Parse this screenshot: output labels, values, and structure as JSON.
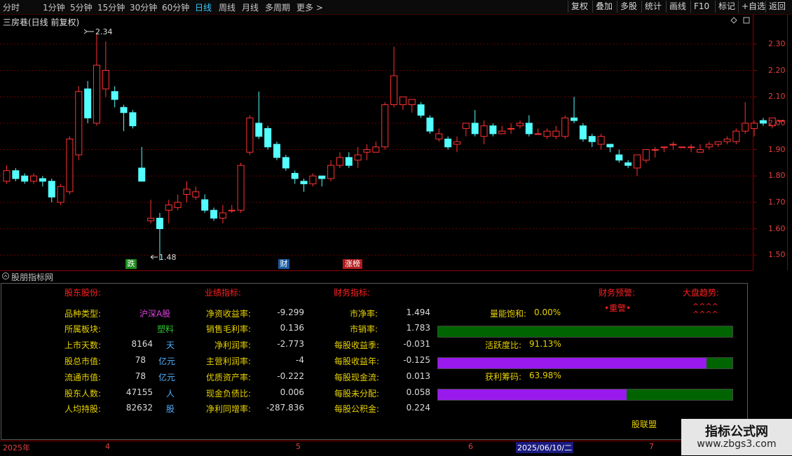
{
  "toolbar": {
    "periods": [
      "分时",
      "1分钟",
      "5分钟",
      "15分钟",
      "30分钟",
      "60分钟",
      "日线",
      "周线",
      "月线",
      "多周期",
      "更多 >"
    ],
    "active_period": "日线",
    "buttons": [
      "复权",
      "叠加",
      "多股",
      "统计",
      "画线",
      "F10",
      "标记",
      "+自选",
      "返回"
    ]
  },
  "chart": {
    "stock_title": "三房巷(日线 前复权)",
    "high_label": "2.34",
    "low_label": "1.48",
    "y_ticks": [
      "2.30",
      "2.20",
      "2.10",
      "2.00",
      "1.90",
      "1.80",
      "1.70",
      "1.60",
      "1.50"
    ],
    "markers": [
      {
        "text": "跌",
        "color": "#1a9a1a"
      },
      {
        "text": "财",
        "color": "#1a5aa0"
      },
      {
        "text": "涨榜",
        "color": "#b01a1a"
      }
    ],
    "up_color": "#ff3232",
    "down_color": "#54ffff"
  },
  "chart_data": {
    "type": "candlestick",
    "ylim": [
      1.45,
      2.39
    ],
    "candles": [
      [
        1.78,
        1.82,
        1.84,
        1.77
      ],
      [
        1.82,
        1.79,
        1.83,
        1.78
      ],
      [
        1.8,
        1.78,
        1.81,
        1.77
      ],
      [
        1.78,
        1.8,
        1.81,
        1.77
      ],
      [
        1.79,
        1.78,
        1.8,
        1.76
      ],
      [
        1.78,
        1.72,
        1.79,
        1.7
      ],
      [
        1.7,
        1.76,
        1.77,
        1.69
      ],
      [
        1.74,
        1.94,
        1.95,
        1.73
      ],
      [
        1.88,
        2.12,
        2.14,
        1.86
      ],
      [
        2.13,
        2.02,
        2.16,
        2.0
      ],
      [
        2.0,
        2.22,
        2.34,
        1.99
      ],
      [
        2.13,
        2.2,
        2.31,
        2.1
      ],
      [
        2.12,
        2.09,
        2.14,
        2.06
      ],
      [
        2.06,
        2.04,
        2.07,
        1.97
      ],
      [
        2.04,
        1.99,
        2.05,
        1.98
      ],
      [
        1.83,
        1.78,
        1.91,
        1.78
      ],
      [
        1.63,
        1.64,
        1.71,
        1.62
      ],
      [
        1.64,
        1.6,
        1.66,
        1.48
      ],
      [
        1.67,
        1.69,
        1.71,
        1.62
      ],
      [
        1.68,
        1.7,
        1.73,
        1.67
      ],
      [
        1.73,
        1.75,
        1.78,
        1.7
      ],
      [
        1.72,
        1.74,
        1.76,
        1.71
      ],
      [
        1.71,
        1.67,
        1.73,
        1.66
      ],
      [
        1.67,
        1.64,
        1.68,
        1.63
      ],
      [
        1.64,
        1.66,
        1.69,
        1.62
      ],
      [
        1.67,
        1.67,
        1.69,
        1.66
      ],
      [
        1.67,
        1.84,
        1.85,
        1.66
      ],
      [
        1.89,
        2.02,
        2.03,
        1.88
      ],
      [
        2.0,
        1.95,
        2.12,
        1.94
      ],
      [
        1.98,
        1.91,
        1.99,
        1.9
      ],
      [
        1.92,
        1.87,
        1.93,
        1.86
      ],
      [
        1.87,
        1.83,
        1.88,
        1.82
      ],
      [
        1.81,
        1.79,
        1.82,
        1.77
      ],
      [
        1.78,
        1.77,
        1.79,
        1.74
      ],
      [
        1.77,
        1.8,
        1.81,
        1.76
      ],
      [
        1.8,
        1.79,
        1.8,
        1.76
      ],
      [
        1.79,
        1.84,
        1.86,
        1.78
      ],
      [
        1.84,
        1.87,
        1.89,
        1.83
      ],
      [
        1.87,
        1.84,
        1.89,
        1.83
      ],
      [
        1.86,
        1.88,
        1.91,
        1.83
      ],
      [
        1.89,
        1.9,
        1.92,
        1.86
      ],
      [
        1.89,
        1.91,
        1.93,
        1.89
      ],
      [
        1.91,
        2.07,
        2.08,
        1.9
      ],
      [
        2.07,
        2.18,
        2.29,
        2.06
      ],
      [
        2.07,
        2.1,
        2.1,
        2.05
      ],
      [
        2.07,
        2.09,
        2.09,
        2.04
      ],
      [
        2.07,
        2.03,
        2.08,
        2.02
      ],
      [
        2.02,
        1.97,
        2.03,
        1.96
      ],
      [
        1.94,
        1.96,
        1.98,
        1.93
      ],
      [
        1.94,
        1.91,
        1.95,
        1.9
      ],
      [
        1.92,
        1.93,
        1.95,
        1.89
      ],
      [
        1.98,
        2.0,
        2.0,
        1.95
      ],
      [
        2.0,
        1.96,
        2.05,
        1.95
      ],
      [
        1.95,
        1.99,
        2.01,
        1.92
      ],
      [
        1.99,
        1.96,
        2.0,
        1.95
      ],
      [
        1.96,
        1.97,
        1.99,
        1.96
      ],
      [
        1.98,
        1.98,
        2.0,
        1.96
      ],
      [
        1.99,
        2.0,
        2.01,
        1.98
      ],
      [
        2.0,
        1.96,
        2.03,
        1.95
      ],
      [
        1.96,
        1.96,
        1.98,
        1.96
      ],
      [
        1.95,
        1.97,
        1.98,
        1.94
      ],
      [
        1.95,
        1.97,
        1.99,
        1.94
      ],
      [
        1.95,
        2.02,
        2.03,
        1.94
      ],
      [
        2.02,
        2.01,
        2.1,
        2.0
      ],
      [
        1.99,
        1.94,
        2.0,
        1.93
      ],
      [
        1.95,
        1.93,
        1.96,
        1.91
      ],
      [
        1.92,
        1.95,
        1.96,
        1.9
      ],
      [
        1.92,
        1.91,
        1.92,
        1.89
      ],
      [
        1.88,
        1.86,
        1.9,
        1.85
      ],
      [
        1.85,
        1.84,
        1.86,
        1.83
      ],
      [
        1.83,
        1.88,
        1.88,
        1.8
      ],
      [
        1.86,
        1.9,
        1.9,
        1.85
      ],
      [
        1.9,
        1.9,
        1.91,
        1.87
      ],
      [
        1.91,
        1.91,
        1.91,
        1.89
      ],
      [
        1.92,
        1.92,
        1.93,
        1.9
      ],
      [
        1.91,
        1.91,
        1.91,
        1.91
      ],
      [
        1.91,
        1.91,
        1.92,
        1.89
      ],
      [
        1.89,
        1.9,
        1.92,
        1.89
      ],
      [
        1.91,
        1.92,
        1.93,
        1.9
      ],
      [
        1.92,
        1.93,
        1.93,
        1.91
      ],
      [
        1.93,
        1.94,
        1.95,
        1.92
      ],
      [
        1.93,
        1.97,
        1.98,
        1.92
      ],
      [
        1.97,
        2.0,
        2.08,
        1.96
      ],
      [
        1.98,
        2.0,
        2.01,
        1.95
      ],
      [
        2.01,
        2.0,
        2.02,
        1.99
      ],
      [
        1.99,
        2.02,
        2.02,
        1.98
      ],
      [
        2.01,
        2.01,
        2.01,
        2.01
      ]
    ]
  },
  "panel": {
    "title": "股朋指标网",
    "sections": {
      "shareholder": "股东股份:",
      "performance": "业绩指标:",
      "finance": "财务指标:",
      "warning": "财务预警:",
      "trend": "大盘趋势:"
    },
    "shareholder_rows": [
      {
        "label": "品种类型:",
        "value": "",
        "unit": "沪深A股"
      },
      {
        "label": "所属板块:",
        "value": "",
        "unit": "塑料"
      },
      {
        "label": "上市天数:",
        "value": "8164",
        "unit": "天"
      },
      {
        "label": "股总市值:",
        "value": "78",
        "unit": "亿元"
      },
      {
        "label": "流通市值:",
        "value": "78",
        "unit": "亿元"
      },
      {
        "label": "股东人数:",
        "value": "47155",
        "unit": "人"
      },
      {
        "label": "人均持股:",
        "value": "82632",
        "unit": "股"
      }
    ],
    "performance_rows": [
      {
        "label": "净资收益率:",
        "value": "-9.299"
      },
      {
        "label": "销售毛利率:",
        "value": "0.136"
      },
      {
        "label": "净利润率:",
        "value": "-2.773"
      },
      {
        "label": "主营利润率:",
        "value": "-4"
      },
      {
        "label": "优质资产率:",
        "value": "-0.222"
      },
      {
        "label": "现金负债比:",
        "value": "0.006"
      },
      {
        "label": "净利同增率:",
        "value": "-287.836"
      }
    ],
    "finance_rows": [
      {
        "label": "市净率:",
        "value": "1.494"
      },
      {
        "label": "市销率:",
        "value": "1.783"
      },
      {
        "label": "每股收益季:",
        "value": "-0.031"
      },
      {
        "label": "每股收益年:",
        "value": "-0.125"
      },
      {
        "label": "每股现金流:",
        "value": "0.013"
      },
      {
        "label": "每股未分配:",
        "value": "0.058"
      },
      {
        "label": "每股公积金:",
        "value": "0.224"
      }
    ],
    "bars": [
      {
        "label": "量能饱和:",
        "value": "0.00%",
        "fraction": 0.0
      },
      {
        "label": "活跃度比:",
        "value": "91.13%",
        "fraction": 0.9113
      },
      {
        "label": "获利筹码:",
        "value": "63.98%",
        "fraction": 0.6398
      }
    ],
    "warning_text": "•重警•",
    "trend_text_1": "^^^^",
    "trend_text_2": "^^^^",
    "footer_label": "股联盟"
  },
  "date_axis": [
    "2025年",
    "4",
    "5",
    "6",
    "2025/06/10/二",
    "7"
  ],
  "watermark": {
    "title": "指标公式网",
    "url": "www.zbgs3.com"
  }
}
